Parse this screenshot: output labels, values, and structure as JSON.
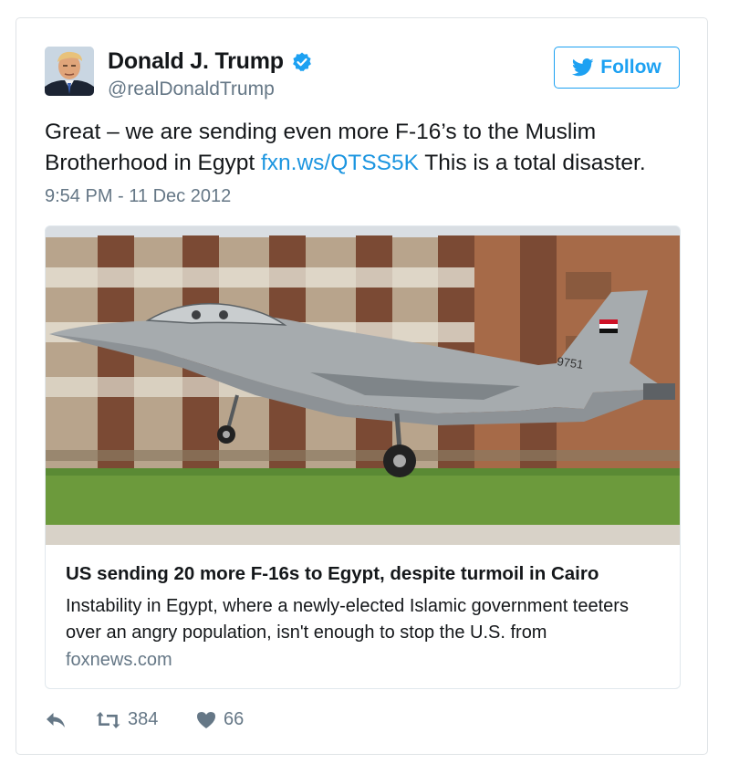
{
  "author": {
    "name": "Donald J. Trump",
    "handle": "@realDonaldTrump",
    "verified": true
  },
  "follow_label": "Follow",
  "tweet": {
    "text_before_link": "Great – we are sending even more F-16’s to the Muslim Brotherhood in Egypt ",
    "link_text": "fxn.ws/QTSS5K",
    "text_after_link": " This is a total disaster.",
    "timestamp": "9:54 PM - 11 Dec 2012"
  },
  "card": {
    "title": "US sending 20 more F-16s to Egypt, despite turmoil in Cairo",
    "description": "Instability in Egypt, where a newly-elected Islamic government teeters over an angry population, isn't enough to stop the U.S. from",
    "domain": "foxnews.com",
    "tail_number": "9751"
  },
  "actions": {
    "retweets": "384",
    "likes": "66"
  },
  "colors": {
    "accent": "#1da1f2",
    "link": "#1b95e0",
    "muted": "#657786",
    "border": "#e1e8ed"
  },
  "icons": {
    "verified": "verified-badge-icon",
    "follow": "twitter-bird-icon",
    "reply": "reply-icon",
    "retweet": "retweet-icon",
    "like": "heart-icon"
  }
}
